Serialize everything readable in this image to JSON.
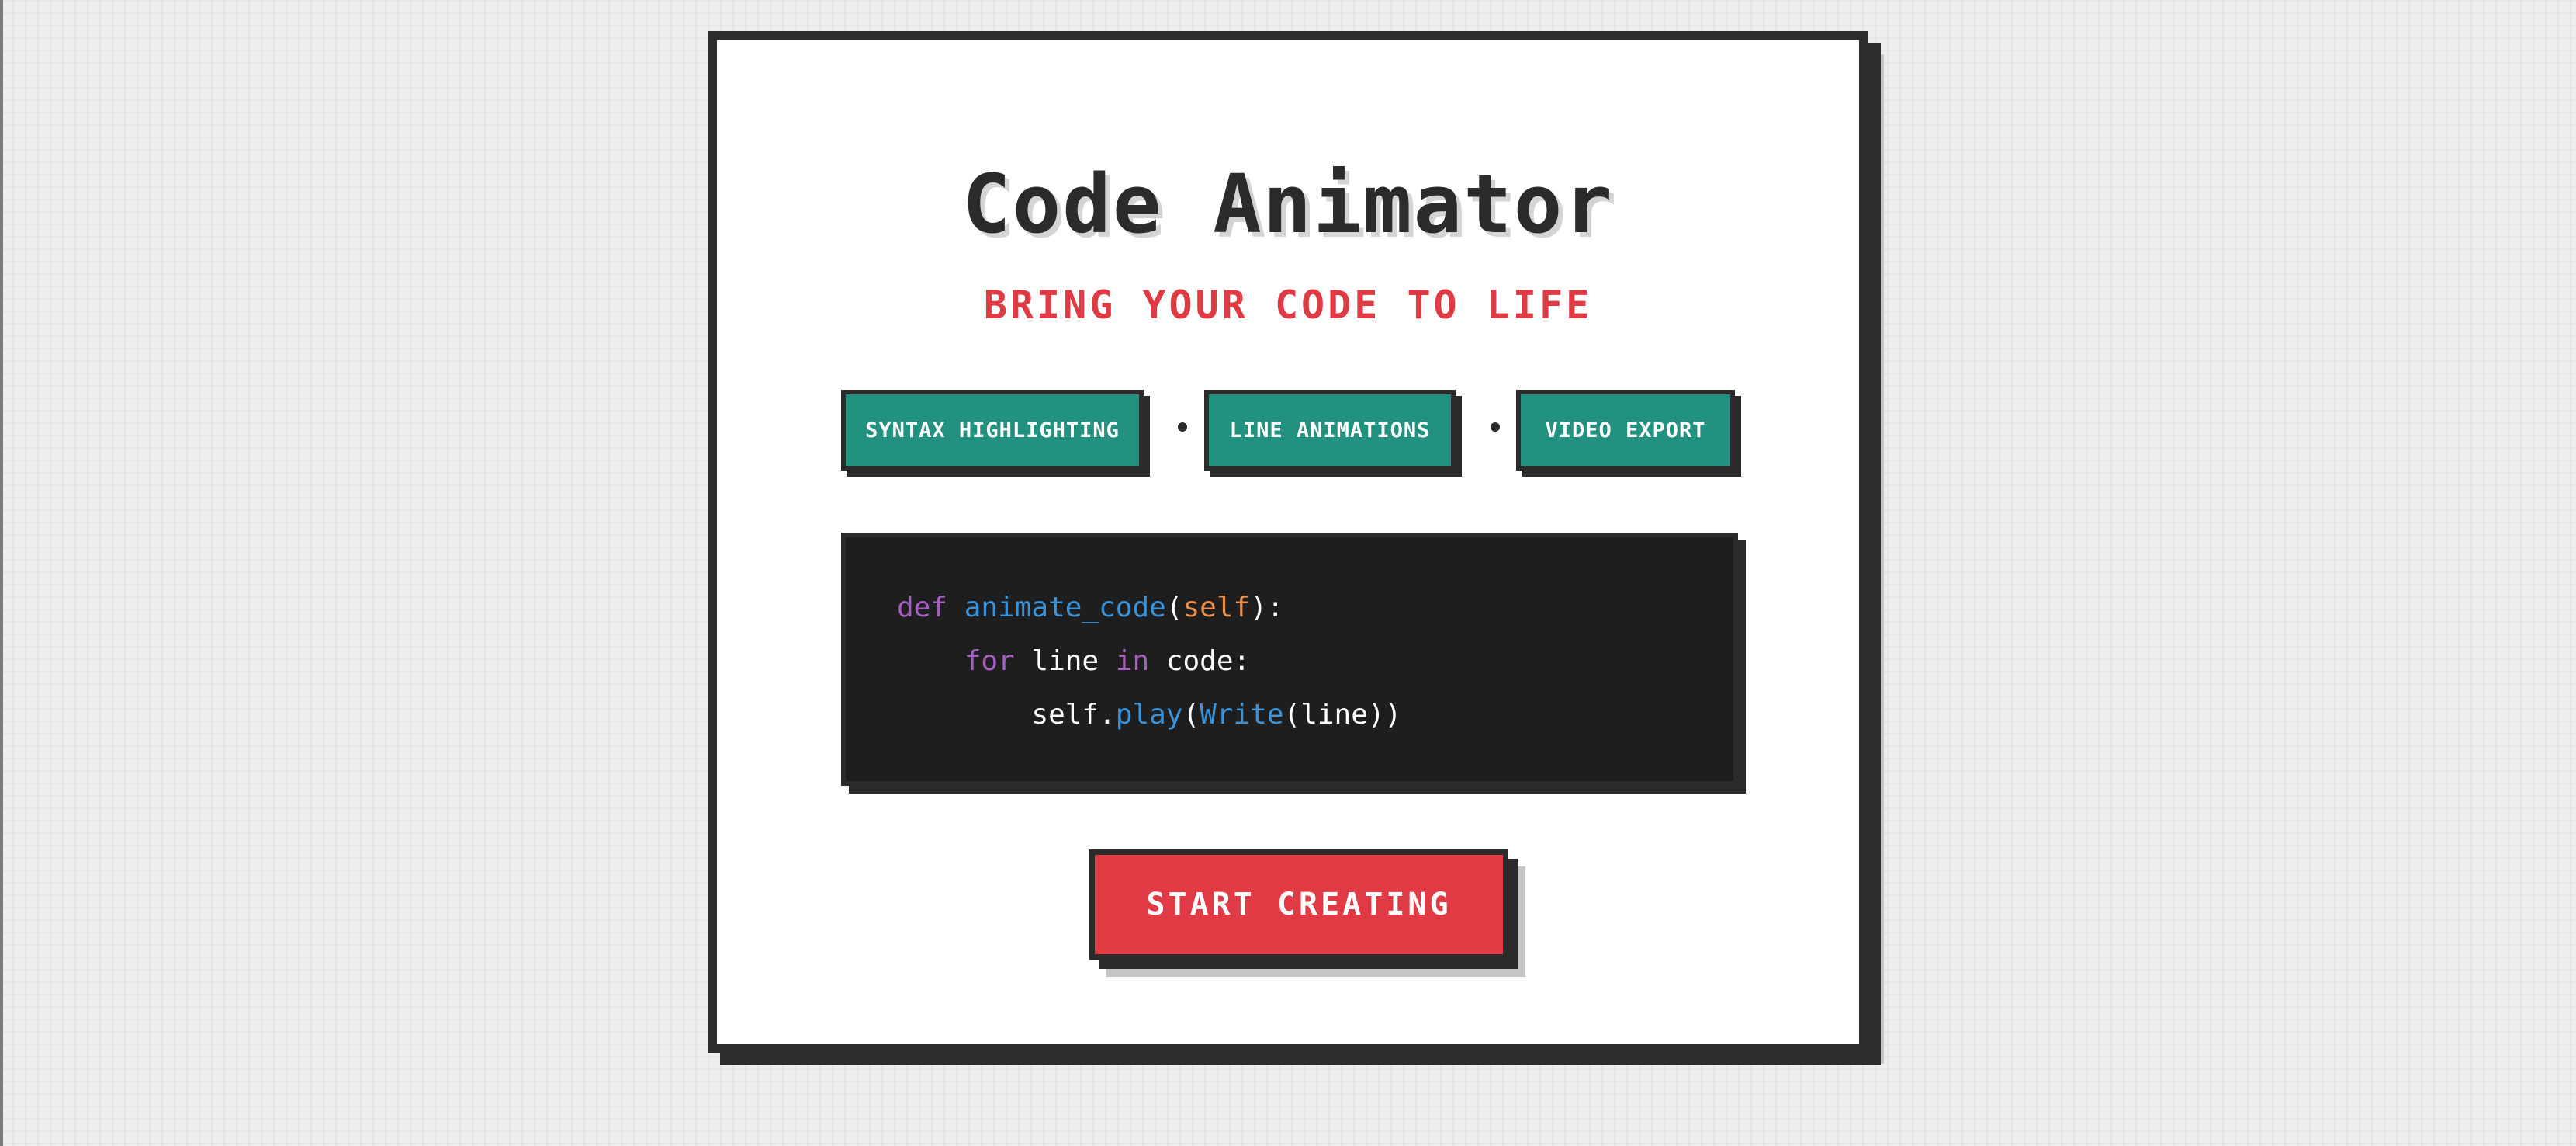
{
  "hero": {
    "title": "Code Animator",
    "subtitle": "BRING YOUR CODE TO LIFE"
  },
  "features": [
    {
      "label": "SYNTAX HIGHLIGHTING"
    },
    {
      "label": "LINE ANIMATIONS"
    },
    {
      "label": "VIDEO EXPORT"
    }
  ],
  "separator": "•",
  "code": {
    "lines": [
      [
        {
          "text": "def",
          "color": "#a45fc0"
        },
        {
          "text": " ",
          "color": "#ffffff"
        },
        {
          "text": "animate_code",
          "color": "#3a92d8"
        },
        {
          "text": "(",
          "color": "#ffffff"
        },
        {
          "text": "self",
          "color": "#e8904e"
        },
        {
          "text": "):",
          "color": "#ffffff"
        }
      ],
      [
        {
          "text": "    ",
          "color": "#ffffff"
        },
        {
          "text": "for",
          "color": "#a45fc0"
        },
        {
          "text": " line ",
          "color": "#ffffff"
        },
        {
          "text": "in",
          "color": "#a45fc0"
        },
        {
          "text": " code:",
          "color": "#ffffff"
        }
      ],
      [
        {
          "text": "        self.",
          "color": "#ffffff"
        },
        {
          "text": "play",
          "color": "#3a92d8"
        },
        {
          "text": "(",
          "color": "#ffffff"
        },
        {
          "text": "Write",
          "color": "#3a92d8"
        },
        {
          "text": "(line))",
          "color": "#ffffff"
        }
      ]
    ]
  },
  "cta": {
    "label": "START CREATING"
  },
  "colors": {
    "accent_red": "#e03a45",
    "tag_teal": "#23917f",
    "ink": "#2b2b2b",
    "code_bg": "#1e1e1e"
  }
}
